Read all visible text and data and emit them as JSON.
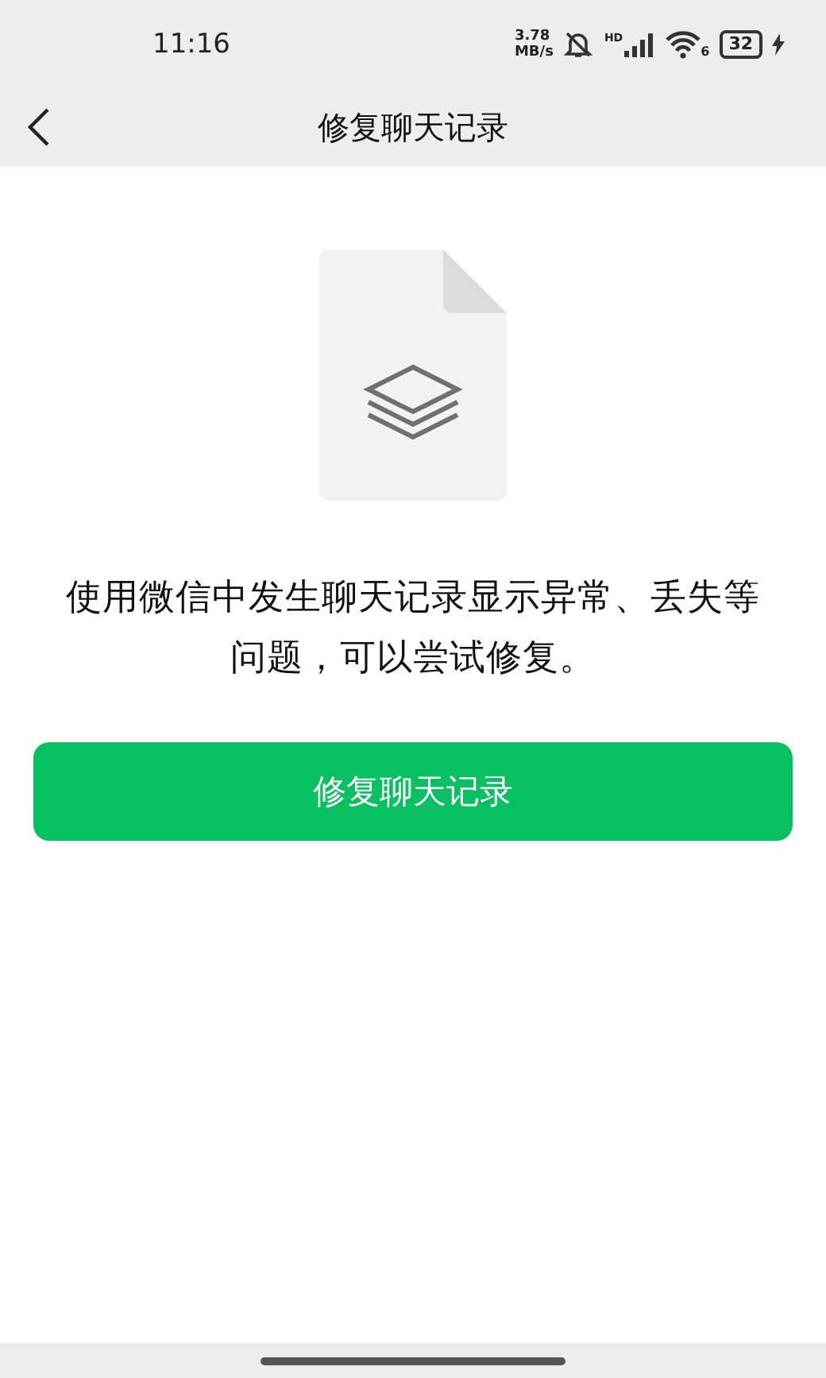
{
  "status_bar": {
    "time": "11:16",
    "speed_value": "3.78",
    "speed_unit": "MB/s",
    "network_label": "HD",
    "wifi_badge": "6",
    "battery": "32"
  },
  "nav": {
    "title": "修复聊天记录"
  },
  "description": "使用微信中发生聊天记录显示异常、丢失等问题，可以尝试修复。",
  "button": {
    "label": "修复聊天记录"
  }
}
